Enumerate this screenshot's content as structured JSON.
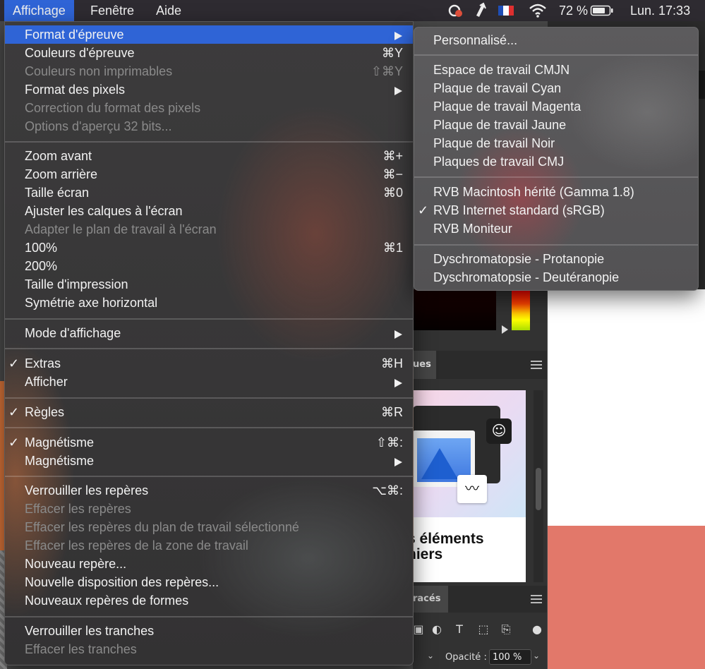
{
  "menubar": {
    "items": [
      "Affichage",
      "Fenêtre",
      "Aide"
    ],
    "battery": "72 %",
    "clock": "Lun. 17:33",
    "input_flag": "FR"
  },
  "view_menu": {
    "items": [
      {
        "label": "Format d'épreuve",
        "submenu": true,
        "highlighted": true
      },
      {
        "label": "Couleurs d'épreuve",
        "shortcut": "⌘Y"
      },
      {
        "label": "Couleurs non imprimables",
        "shortcut": "⇧⌘Y",
        "disabled": true
      },
      {
        "label": "Format des pixels",
        "submenu": true
      },
      {
        "label": "Correction du format des pixels",
        "disabled": true
      },
      {
        "label": "Options d'aperçu 32 bits...",
        "disabled": true
      },
      {
        "label": "Zoom avant",
        "shortcut": "⌘+"
      },
      {
        "label": "Zoom arrière",
        "shortcut": "⌘−"
      },
      {
        "label": "Taille écran",
        "shortcut": "⌘0"
      },
      {
        "label": "Ajuster les calques à l'écran"
      },
      {
        "label": "Adapter le plan de travail à l'écran",
        "disabled": true
      },
      {
        "label": "100%",
        "shortcut": "⌘1"
      },
      {
        "label": "200%"
      },
      {
        "label": "Taille d'impression"
      },
      {
        "label": "Symétrie axe horizontal"
      },
      {
        "label": "Mode d'affichage",
        "submenu": true
      },
      {
        "label": "Extras",
        "shortcut": "⌘H",
        "checked": true
      },
      {
        "label": "Afficher",
        "submenu": true
      },
      {
        "label": "Règles",
        "shortcut": "⌘R",
        "checked": true
      },
      {
        "label": "Magnétisme",
        "shortcut": "⇧⌘:",
        "checked": true
      },
      {
        "label": "Magnétisme",
        "submenu": true
      },
      {
        "label": "Verrouiller les repères",
        "shortcut": "⌥⌘:"
      },
      {
        "label": "Effacer les repères",
        "disabled": true
      },
      {
        "label": "Effacer les repères du plan de travail sélectionné",
        "disabled": true
      },
      {
        "label": "Effacer les repères de la zone de travail",
        "disabled": true
      },
      {
        "label": "Nouveau repère..."
      },
      {
        "label": "Nouvelle disposition des repères..."
      },
      {
        "label": "Nouveaux repères de formes"
      },
      {
        "label": "Verrouiller les tranches"
      },
      {
        "label": "Effacer les tranches",
        "disabled": true
      }
    ]
  },
  "proof_submenu": {
    "items": [
      {
        "label": "Personnalisé..."
      },
      {
        "label": "Espace de travail CMJN"
      },
      {
        "label": "Plaque de travail Cyan"
      },
      {
        "label": "Plaque de travail Magenta"
      },
      {
        "label": "Plaque de travail Jaune"
      },
      {
        "label": "Plaque de travail Noir"
      },
      {
        "label": "Plaques de travail CMJ"
      },
      {
        "label": "RVB Macintosh hérité (Gamma 1.8)"
      },
      {
        "label": "RVB Internet standard (sRGB)",
        "checked": true
      },
      {
        "label": "RVB Moniteur"
      },
      {
        "label": "Dyschromatopsie - Protanopie"
      },
      {
        "label": "Dyschromatopsie - Deutéranopie"
      }
    ]
  },
  "background": {
    "panel_tab_1": "ues",
    "learn_card_title": "s éléments\nniers",
    "panel_tab_2": "racés",
    "opacity_label": "Opacité :",
    "opacity_value": "100 %"
  },
  "colors": {
    "menubar_bg": "#2e2b31",
    "highlight": "#2f64d6",
    "disabled_text": "#8a8a8a",
    "salmon": "#e2786a"
  }
}
